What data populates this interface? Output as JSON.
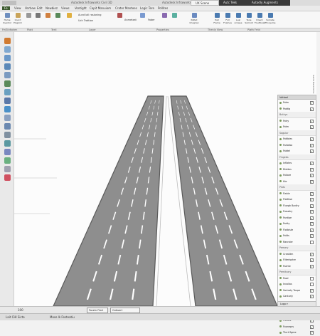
{
  "window": {
    "title": "Autodesk Infraworks Civil 3D",
    "center_title": "Autodesk Infraworks",
    "tabs": [
      {
        "label": "UX Scene",
        "active": true
      },
      {
        "label": "Autc Tekk",
        "active": false
      },
      {
        "label": "Autodly Augments",
        "active": false
      }
    ]
  },
  "ribbon": {
    "tabs": [
      "Fe",
      "View",
      "Vertiew",
      "Edit",
      "Newbiez",
      "Views",
      "Vontight",
      "Capit Manuiom",
      "Crater Mantees",
      "Logic Tere",
      "Pollites"
    ],
    "buttons": [
      {
        "label": "Home Inventor"
      },
      {
        "label": "Coord Plugnim"
      }
    ],
    "lines": [
      "Aund lall rasioning",
      "Uch Trattion"
    ],
    "small_labels": [
      "Anmetzat",
      "Faber"
    ],
    "right_buttons": [
      "Pattet Imagirex",
      "Pall Frame",
      "Fnll Fnames",
      "Lual Arowse",
      "Tene Samnot",
      "Dnent Foudtiwall",
      "Somate Fincgume"
    ]
  },
  "groups": [
    "Fe/Slidtoken",
    "Plott",
    "Tertl",
    "Layer",
    "Properties",
    "Thenly View",
    "Plath Frrld"
  ],
  "panel": {
    "title": "Vattoel",
    "rows": [
      {
        "label": "Fatm",
        "type": "item",
        "checked": true
      },
      {
        "label": "Padtiq",
        "type": "item",
        "checked": true
      },
      {
        "label": "Buthys",
        "type": "section"
      },
      {
        "label": "Fatry",
        "type": "item",
        "checked": true
      },
      {
        "label": "Fatm",
        "type": "item",
        "checked": true
      },
      {
        "label": "Sagular",
        "type": "section"
      },
      {
        "label": "Fattbles",
        "type": "item",
        "checked": true
      },
      {
        "label": "Farbeba",
        "type": "item",
        "checked": true
      },
      {
        "label": "Fabtel",
        "type": "item",
        "checked": true
      },
      {
        "label": "Fingebs",
        "type": "section"
      },
      {
        "label": "Inflates",
        "type": "item",
        "checked": true
      },
      {
        "label": "Diettes",
        "type": "item",
        "checked": true
      },
      {
        "label": "Fatiare",
        "type": "item",
        "checked": true
      },
      {
        "label": "Hie",
        "type": "item",
        "checked": true
      },
      {
        "label": "Plots",
        "type": "section"
      },
      {
        "label": "Fiahle",
        "type": "item",
        "checked": true
      },
      {
        "label": "Flattlwe",
        "type": "item",
        "checked": true
      },
      {
        "label": "Fluegh Badiry",
        "type": "item",
        "checked": true
      },
      {
        "label": "Frasetry",
        "type": "item",
        "checked": true
      },
      {
        "label": "Fantipe",
        "type": "item",
        "checked": true
      },
      {
        "label": "Fartty",
        "type": "item",
        "checked": true
      },
      {
        "label": "Flotbiste",
        "type": "item",
        "checked": true
      },
      {
        "label": "Fatlts",
        "type": "item",
        "checked": true
      },
      {
        "label": "Rannder",
        "type": "item",
        "checked": false
      },
      {
        "label": "Pemary",
        "type": "section"
      },
      {
        "label": "Creatitm",
        "type": "item",
        "checked": true
      },
      {
        "label": "Flitmtsatre",
        "type": "item",
        "checked": true
      },
      {
        "label": "Fachte",
        "type": "item",
        "checked": true
      },
      {
        "label": "Pemitcary",
        "type": "section"
      },
      {
        "label": "Fasd",
        "type": "item",
        "checked": false
      },
      {
        "label": "Invoilas",
        "type": "item",
        "checked": false
      },
      {
        "label": "Sortraty Toupe",
        "type": "item",
        "checked": true
      },
      {
        "label": "Cantoriy",
        "type": "item",
        "checked": true
      },
      {
        "label": "Cartes",
        "type": "item",
        "checked": true
      },
      {
        "label": "Cut",
        "type": "item",
        "checked": true
      },
      {
        "label": "Pewrady Ropes",
        "type": "section"
      },
      {
        "label": "Fiebles",
        "type": "item",
        "checked": true
      },
      {
        "label": "Fooneprs",
        "type": "item",
        "checked": true
      },
      {
        "label": "Thrrt Sgme",
        "type": "item",
        "checked": true
      }
    ],
    "footer": "Lopp ▾"
  },
  "bottombar": {
    "zoom": "100",
    "tool_a": "Faceln Flert",
    "tool_b": "Catiuert"
  },
  "statusbar": {
    "left": "Lait CHI Sicte",
    "mid": "Mose lk Festeatiu"
  },
  "vertical_text": "Ganlis Bankdome",
  "colors": {
    "accent": "#3c5a2f",
    "road": "#8e8e8e",
    "road_edge": "#5a5a5a",
    "marking": "#ffffff",
    "viewport_bg": "#fcfcfc"
  },
  "icons": [
    "orange-wrench-icon",
    "pencil-icon",
    "road-icon",
    "cube-icon",
    "bridge-icon",
    "tree-icon",
    "pipe-icon",
    "building-icon",
    "water-icon",
    "lamp-icon",
    "search-icon",
    "gear-icon",
    "layers-icon",
    "camera-icon",
    "terrain-icon",
    "eraser-icon"
  ]
}
